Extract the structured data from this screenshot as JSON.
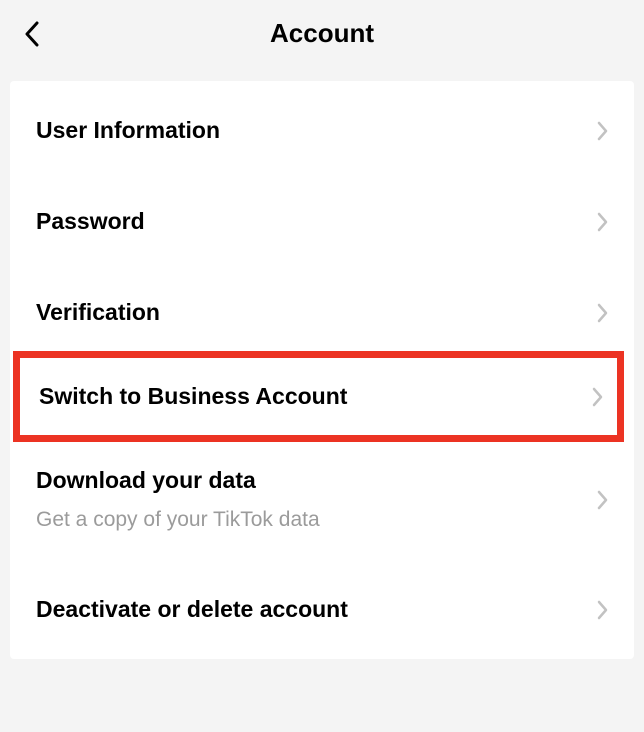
{
  "header": {
    "title": "Account"
  },
  "items": [
    {
      "label": "User Information"
    },
    {
      "label": "Password"
    },
    {
      "label": "Verification"
    },
    {
      "label": "Switch to Business Account"
    },
    {
      "label": "Download your data",
      "sublabel": "Get a copy of your TikTok data"
    },
    {
      "label": "Deactivate or delete account"
    }
  ]
}
